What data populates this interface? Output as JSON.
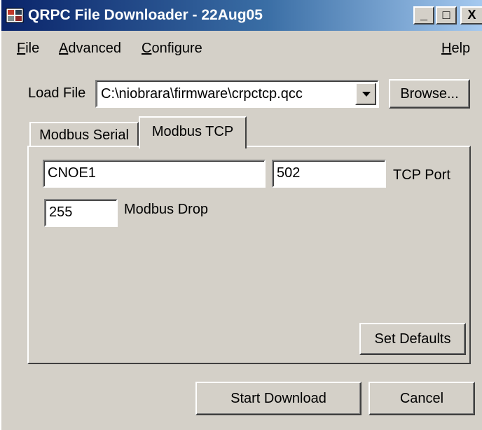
{
  "window": {
    "title": "QRPC File Downloader - 22Aug05",
    "minimize_glyph": "_",
    "maximize_glyph": "□",
    "close_glyph": "X"
  },
  "menu": {
    "file": {
      "accel": "F",
      "rest": "ile"
    },
    "advanced": {
      "accel": "A",
      "rest": "dvanced"
    },
    "configure": {
      "accel": "C",
      "rest": "onfigure"
    },
    "help": {
      "accel": "H",
      "rest": "elp"
    }
  },
  "load_file": {
    "label": "Load File",
    "value": "C:\\niobrara\\firmware\\crpctcp.qcc",
    "browse_label": "Browse..."
  },
  "tabs": [
    {
      "label": "Modbus Serial",
      "active": false
    },
    {
      "label": "Modbus TCP",
      "active": true
    }
  ],
  "tcp_panel": {
    "host_value": "CNOE1",
    "port_value": "502",
    "port_label": "TCP Port",
    "drop_value": "255",
    "drop_label": "Modbus Drop",
    "set_defaults_label": "Set Defaults"
  },
  "footer": {
    "start_label": "Start Download",
    "cancel_label": "Cancel"
  },
  "colors": {
    "face": "#d4d0c8",
    "title_start": "#0a246a",
    "title_end": "#a6caf0"
  }
}
